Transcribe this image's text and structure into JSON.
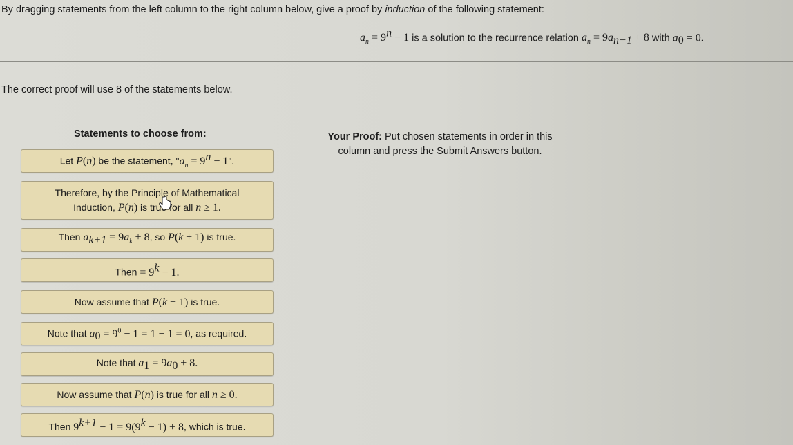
{
  "instructions": {
    "prefix": "By dragging statements from the left column to the right column below, give a proof by ",
    "emphasis": "induction",
    "suffix": " of the following statement:"
  },
  "statement": {
    "formula": "a_n = 9^n − 1",
    "text": " is a solution to the recurrence relation ",
    "recurrence": "a_n = 9a_{n−1} + 8",
    "with_text": " with ",
    "initial": "a_0 = 0."
  },
  "count_note": "The correct proof will use 8 of the statements below.",
  "left_column": {
    "heading": "Statements to choose from:",
    "statements": [
      {
        "id": 1,
        "text": "Let P(n) be the statement, \"a_n = 9^n − 1\"."
      },
      {
        "id": 2,
        "text": "Therefore, by the Principle of Mathematical Induction, P(n) is true for all n ≥ 1."
      },
      {
        "id": 3,
        "text": "Then a_{k+1} = 9a_k + 8, so P(k + 1) is true."
      },
      {
        "id": 4,
        "text": "Then = 9^k − 1."
      },
      {
        "id": 5,
        "text": "Now assume that P(k + 1) is true."
      },
      {
        "id": 6,
        "text": "Note that a_0 = 9^0 − 1 = 1 − 1 = 0, as required."
      },
      {
        "id": 7,
        "text": "Note that a_1 = 9a_0 + 8."
      },
      {
        "id": 8,
        "text": "Now assume that P(n) is true for all n ≥ 0."
      },
      {
        "id": 9,
        "text": "Then 9^{k+1} − 1 = 9(9^k − 1) + 8, which is true."
      }
    ]
  },
  "right_column": {
    "heading_bold": "Your Proof:",
    "heading_rest": " Put chosen statements in order in this column and press the Submit Answers button.",
    "statements": []
  }
}
